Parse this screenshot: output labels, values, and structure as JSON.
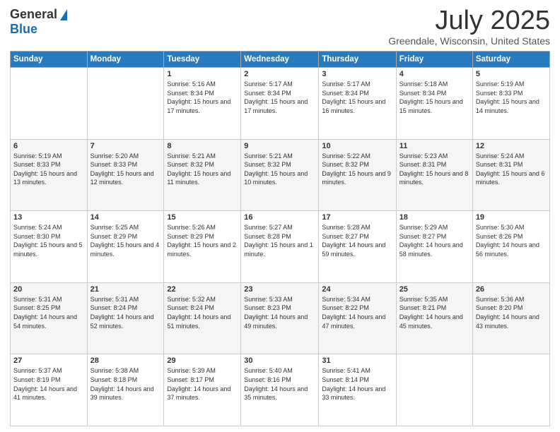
{
  "header": {
    "logo_general": "General",
    "logo_blue": "Blue",
    "month_title": "July 2025",
    "location": "Greendale, Wisconsin, United States"
  },
  "weekdays": [
    "Sunday",
    "Monday",
    "Tuesday",
    "Wednesday",
    "Thursday",
    "Friday",
    "Saturday"
  ],
  "weeks": [
    [
      {
        "day": "",
        "info": ""
      },
      {
        "day": "",
        "info": ""
      },
      {
        "day": "1",
        "info": "Sunrise: 5:16 AM\nSunset: 8:34 PM\nDaylight: 15 hours and 17 minutes."
      },
      {
        "day": "2",
        "info": "Sunrise: 5:17 AM\nSunset: 8:34 PM\nDaylight: 15 hours and 17 minutes."
      },
      {
        "day": "3",
        "info": "Sunrise: 5:17 AM\nSunset: 8:34 PM\nDaylight: 15 hours and 16 minutes."
      },
      {
        "day": "4",
        "info": "Sunrise: 5:18 AM\nSunset: 8:34 PM\nDaylight: 15 hours and 15 minutes."
      },
      {
        "day": "5",
        "info": "Sunrise: 5:19 AM\nSunset: 8:33 PM\nDaylight: 15 hours and 14 minutes."
      }
    ],
    [
      {
        "day": "6",
        "info": "Sunrise: 5:19 AM\nSunset: 8:33 PM\nDaylight: 15 hours and 13 minutes."
      },
      {
        "day": "7",
        "info": "Sunrise: 5:20 AM\nSunset: 8:33 PM\nDaylight: 15 hours and 12 minutes."
      },
      {
        "day": "8",
        "info": "Sunrise: 5:21 AM\nSunset: 8:32 PM\nDaylight: 15 hours and 11 minutes."
      },
      {
        "day": "9",
        "info": "Sunrise: 5:21 AM\nSunset: 8:32 PM\nDaylight: 15 hours and 10 minutes."
      },
      {
        "day": "10",
        "info": "Sunrise: 5:22 AM\nSunset: 8:32 PM\nDaylight: 15 hours and 9 minutes."
      },
      {
        "day": "11",
        "info": "Sunrise: 5:23 AM\nSunset: 8:31 PM\nDaylight: 15 hours and 8 minutes."
      },
      {
        "day": "12",
        "info": "Sunrise: 5:24 AM\nSunset: 8:31 PM\nDaylight: 15 hours and 6 minutes."
      }
    ],
    [
      {
        "day": "13",
        "info": "Sunrise: 5:24 AM\nSunset: 8:30 PM\nDaylight: 15 hours and 5 minutes."
      },
      {
        "day": "14",
        "info": "Sunrise: 5:25 AM\nSunset: 8:29 PM\nDaylight: 15 hours and 4 minutes."
      },
      {
        "day": "15",
        "info": "Sunrise: 5:26 AM\nSunset: 8:29 PM\nDaylight: 15 hours and 2 minutes."
      },
      {
        "day": "16",
        "info": "Sunrise: 5:27 AM\nSunset: 8:28 PM\nDaylight: 15 hours and 1 minute."
      },
      {
        "day": "17",
        "info": "Sunrise: 5:28 AM\nSunset: 8:27 PM\nDaylight: 14 hours and 59 minutes."
      },
      {
        "day": "18",
        "info": "Sunrise: 5:29 AM\nSunset: 8:27 PM\nDaylight: 14 hours and 58 minutes."
      },
      {
        "day": "19",
        "info": "Sunrise: 5:30 AM\nSunset: 8:26 PM\nDaylight: 14 hours and 56 minutes."
      }
    ],
    [
      {
        "day": "20",
        "info": "Sunrise: 5:31 AM\nSunset: 8:25 PM\nDaylight: 14 hours and 54 minutes."
      },
      {
        "day": "21",
        "info": "Sunrise: 5:31 AM\nSunset: 8:24 PM\nDaylight: 14 hours and 52 minutes."
      },
      {
        "day": "22",
        "info": "Sunrise: 5:32 AM\nSunset: 8:24 PM\nDaylight: 14 hours and 51 minutes."
      },
      {
        "day": "23",
        "info": "Sunrise: 5:33 AM\nSunset: 8:23 PM\nDaylight: 14 hours and 49 minutes."
      },
      {
        "day": "24",
        "info": "Sunrise: 5:34 AM\nSunset: 8:22 PM\nDaylight: 14 hours and 47 minutes."
      },
      {
        "day": "25",
        "info": "Sunrise: 5:35 AM\nSunset: 8:21 PM\nDaylight: 14 hours and 45 minutes."
      },
      {
        "day": "26",
        "info": "Sunrise: 5:36 AM\nSunset: 8:20 PM\nDaylight: 14 hours and 43 minutes."
      }
    ],
    [
      {
        "day": "27",
        "info": "Sunrise: 5:37 AM\nSunset: 8:19 PM\nDaylight: 14 hours and 41 minutes."
      },
      {
        "day": "28",
        "info": "Sunrise: 5:38 AM\nSunset: 8:18 PM\nDaylight: 14 hours and 39 minutes."
      },
      {
        "day": "29",
        "info": "Sunrise: 5:39 AM\nSunset: 8:17 PM\nDaylight: 14 hours and 37 minutes."
      },
      {
        "day": "30",
        "info": "Sunrise: 5:40 AM\nSunset: 8:16 PM\nDaylight: 14 hours and 35 minutes."
      },
      {
        "day": "31",
        "info": "Sunrise: 5:41 AM\nSunset: 8:14 PM\nDaylight: 14 hours and 33 minutes."
      },
      {
        "day": "",
        "info": ""
      },
      {
        "day": "",
        "info": ""
      }
    ]
  ]
}
